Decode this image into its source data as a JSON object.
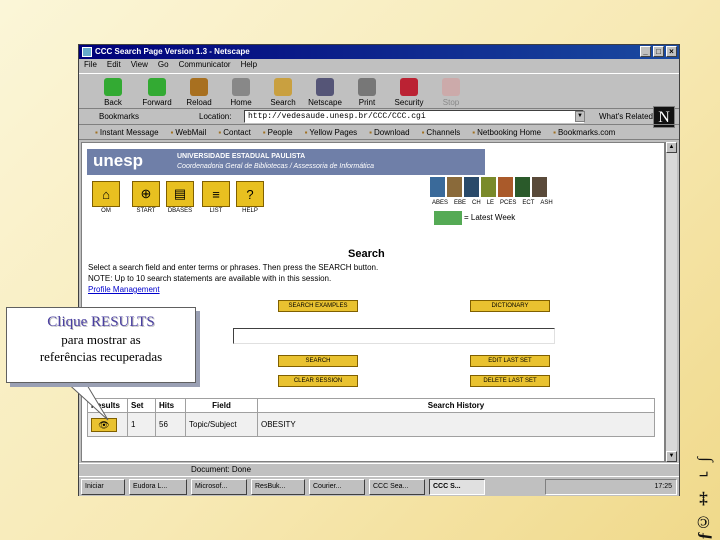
{
  "window": {
    "title": "CCC Search Page Version 1.3 - Netscape",
    "controls": [
      "_",
      "□",
      "×"
    ]
  },
  "menu": [
    "File",
    "Edit",
    "View",
    "Go",
    "Communicator",
    "Help"
  ],
  "toolbar": [
    {
      "label": "Back",
      "icon": "back-arrow-icon"
    },
    {
      "label": "Forward",
      "icon": "forward-arrow-icon"
    },
    {
      "label": "Reload",
      "icon": "reload-icon"
    },
    {
      "label": "Home",
      "icon": "home-icon"
    },
    {
      "label": "Search",
      "icon": "search-icon"
    },
    {
      "label": "Netscape",
      "icon": "netscape-icon"
    },
    {
      "label": "Print",
      "icon": "print-icon"
    },
    {
      "label": "Security",
      "icon": "lock-icon"
    },
    {
      "label": "Stop",
      "icon": "stop-icon"
    }
  ],
  "location": {
    "bookmarks": "Bookmarks",
    "label": "Location:",
    "url": "http://vedesaude.unesp.br/CCC/CCC.cgi",
    "whats_related": "What's Related"
  },
  "personal_toolbar": [
    "Instant Message",
    "WebMail",
    "Contact",
    "People",
    "Yellow Pages",
    "Download",
    "Channels",
    "Netbooking Home",
    "Bookmarks.com"
  ],
  "page": {
    "banner": {
      "logo": "unesp",
      "line1": "UNIVERSIDADE ESTADUAL PAULISTA",
      "line2": "Coordenadoria Geral de Bibliotecas / Assessoria de Informática"
    },
    "nav_buttons": [
      {
        "label": "OM",
        "glyph": "⌂"
      },
      {
        "label": "START",
        "glyph": "⊕"
      },
      {
        "label": "DBASES",
        "glyph": "▤"
      },
      {
        "label": "LIST",
        "glyph": "≡"
      },
      {
        "label": "HELP",
        "glyph": "?"
      }
    ],
    "databases": [
      "ABES",
      "EBE",
      "CH",
      "LE",
      "PCES",
      "ECT",
      "ASH"
    ],
    "database_colors": [
      "#3a6a9a",
      "#8a6a3a",
      "#2a4a6a",
      "#7a8a2a",
      "#aa5a2a",
      "#2a5a2a",
      "#5a4a3a"
    ],
    "legend": "= Latest Week",
    "search_heading": "Search",
    "instructions": [
      "Select a search field and enter terms or phrases. Then press the SEARCH button.",
      "NOTE: Up to 10 search statements are available with in this session."
    ],
    "profile_link": "Profile Management",
    "buttons": {
      "search_examples": "SEARCH EXAMPLES",
      "dictionary": "DICTIONARY",
      "search": "SEARCH",
      "edit_last_set": "EDIT LAST SET",
      "clear_session": "CLEAR SESSION",
      "delete_last_set": "DELETE LAST SET"
    },
    "search_input_value": "",
    "history": {
      "headers": [
        "Results",
        "Set",
        "Hits",
        "Field",
        "Search History"
      ],
      "rows": [
        {
          "set": "1",
          "hits": "56",
          "field": "Topic/Subject",
          "history": "OBESITY"
        }
      ]
    }
  },
  "status_text": "Document: Done",
  "taskbar": {
    "start": "Iniciar",
    "tasks": [
      "Eudora L...",
      "Microsof...",
      "ResBuk...",
      "Courier...",
      "CCC Sea...",
      "CCC S..."
    ],
    "time": "17:25"
  },
  "callout": {
    "title": "Clique RESULTS",
    "line1": "para mostrar as",
    "line2": "referências recuperadas"
  },
  "brand_mark": "ƒ© ‡ ⌐ ∫",
  "colors": {
    "slide_bg": "#f7e9b4",
    "banner": "#6f7fa8",
    "button_yellow": "#e9c230",
    "title_bar": "#00007a"
  }
}
